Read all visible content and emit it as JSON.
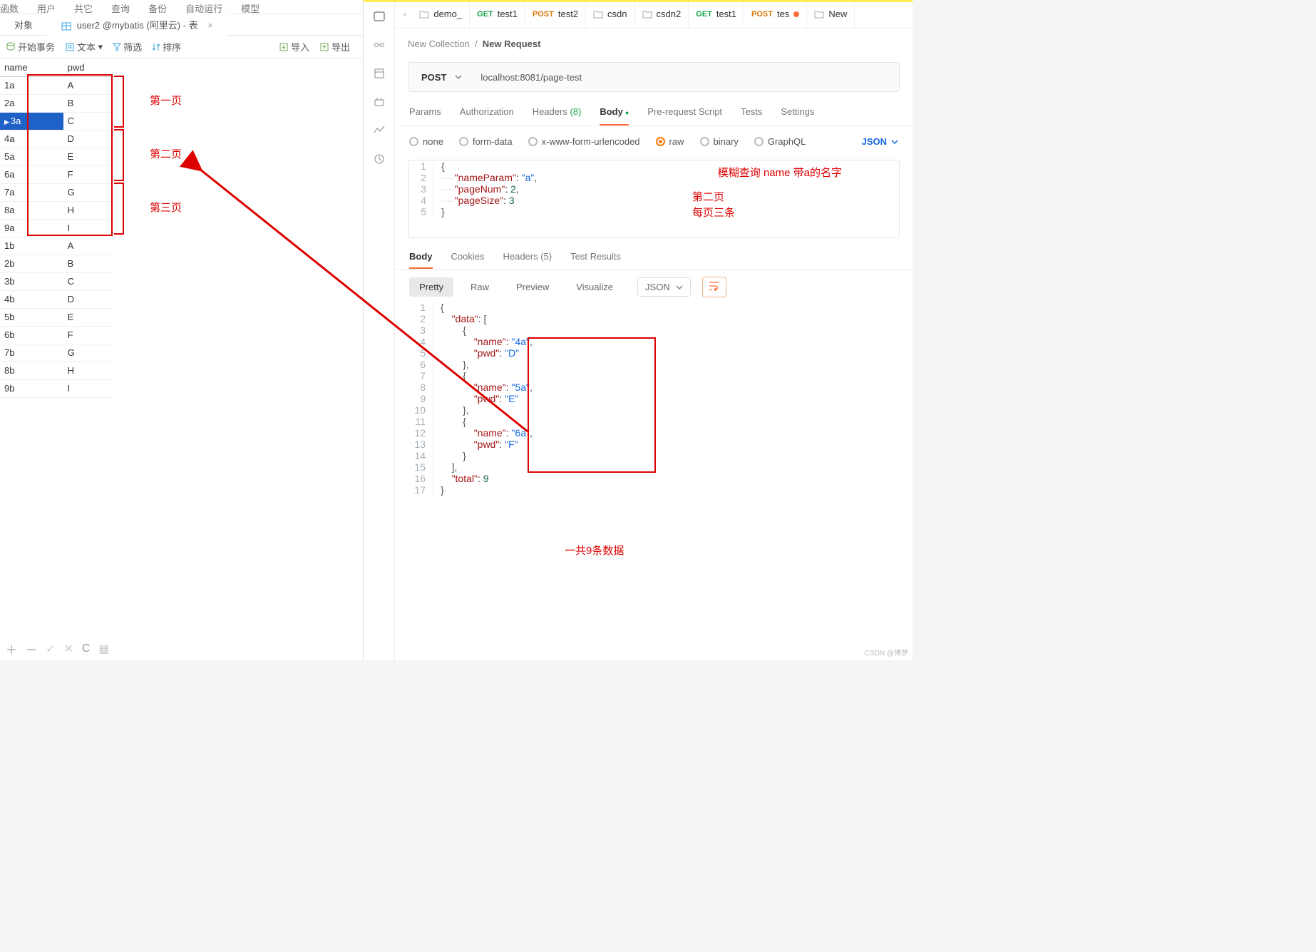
{
  "left": {
    "menus": [
      "函数",
      "用户",
      "共它",
      "查询",
      "备份",
      "自动运行",
      "模型"
    ],
    "tabs": [
      {
        "label": "对象"
      },
      {
        "label": "user2 @mybatis (阿里云) - 表",
        "icon": "table"
      }
    ],
    "toolbar": {
      "start_tx": "开始事务",
      "text": "文本",
      "filter": "筛选",
      "sort": "排序",
      "import": "导入",
      "export": "导出"
    },
    "columns": [
      "name",
      "pwd"
    ],
    "rows": [
      {
        "name": "1a",
        "pwd": "A"
      },
      {
        "name": "2a",
        "pwd": "B"
      },
      {
        "name": "3a",
        "pwd": "C",
        "selected": true
      },
      {
        "name": "4a",
        "pwd": "D"
      },
      {
        "name": "5a",
        "pwd": "E"
      },
      {
        "name": "6a",
        "pwd": "F"
      },
      {
        "name": "7a",
        "pwd": "G"
      },
      {
        "name": "8a",
        "pwd": "H"
      },
      {
        "name": "9a",
        "pwd": "I"
      },
      {
        "name": "1b",
        "pwd": "A"
      },
      {
        "name": "2b",
        "pwd": "B"
      },
      {
        "name": "3b",
        "pwd": "C"
      },
      {
        "name": "4b",
        "pwd": "D"
      },
      {
        "name": "5b",
        "pwd": "E"
      },
      {
        "name": "6b",
        "pwd": "F"
      },
      {
        "name": "7b",
        "pwd": "G"
      },
      {
        "name": "8b",
        "pwd": "H"
      },
      {
        "name": "9b",
        "pwd": "I"
      }
    ],
    "annotations": {
      "page1": "第一页",
      "page2": "第二页",
      "page3": "第三页"
    },
    "bottom_tools": {
      "plus": "＋",
      "minus": "－",
      "check": "✓",
      "x": "✕",
      "refresh": "C",
      "grid": "▦"
    }
  },
  "right": {
    "tabs": [
      {
        "label": "demo_",
        "type": "folder"
      },
      {
        "label": "test1",
        "method": "GET"
      },
      {
        "label": "test2",
        "method": "POST"
      },
      {
        "label": "csdn",
        "type": "folder"
      },
      {
        "label": "csdn2",
        "type": "folder"
      },
      {
        "label": "test1",
        "method": "GET"
      },
      {
        "label": "tes",
        "method": "POST",
        "changed": true
      },
      {
        "label": "New",
        "type": "folder"
      }
    ],
    "crumbs": {
      "collection": "New Collection",
      "sep": "/",
      "request": "New Request"
    },
    "request": {
      "method": "POST",
      "url": "localhost:8081/page-test"
    },
    "req_tabs": {
      "params": "Params",
      "auth": "Authorization",
      "headers": "Headers",
      "headers_count": "(8)",
      "body": "Body",
      "prereq": "Pre-request Script",
      "tests": "Tests",
      "settings": "Settings"
    },
    "body_types": {
      "none": "none",
      "form": "form-data",
      "urlenc": "x-www-form-urlencoded",
      "raw": "raw",
      "binary": "binary",
      "graphql": "GraphQL",
      "json": "JSON"
    },
    "body_code": [
      "{",
      "····\"nameParam\":\"a\",",
      "····\"pageNum\":2,",
      "····\"pageSize\":3",
      "}"
    ],
    "body_annotations": {
      "ann1": "模糊查询 name 带a的名字",
      "ann2": "第二页",
      "ann3": "每页三条"
    },
    "resp_tabs": {
      "body": "Body",
      "cookies": "Cookies",
      "headers": "Headers",
      "headers_count": "(5)",
      "tests": "Test Results"
    },
    "viewbar": {
      "pretty": "Pretty",
      "raw": "Raw",
      "preview": "Preview",
      "visualize": "Visualize",
      "lang": "JSON"
    },
    "resp_code": [
      "{",
      "    \"data\": [",
      "        {",
      "            \"name\": \"4a\",",
      "            \"pwd\": \"D\"",
      "        },",
      "        {",
      "            \"name\": \"5a\",",
      "            \"pwd\": \"E\"",
      "        },",
      "        {",
      "            \"name\": \"6a\",",
      "            \"pwd\": \"F\"",
      "        }",
      "    ],",
      "    \"total\": 9",
      "}"
    ],
    "resp_annotation": "一共9条数据",
    "watermark": "CSDN @博梦"
  }
}
